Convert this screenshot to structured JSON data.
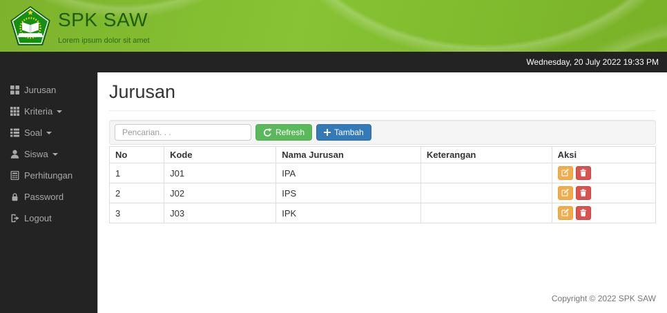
{
  "header": {
    "title": "SPK SAW",
    "subtitle": "Lorem ipsum dolor sit amet",
    "logo": "kemenag-pentagon-logo"
  },
  "topbar": {
    "datetime": "Wednesday, 20 July 2022 19:33 PM"
  },
  "sidebar": {
    "items": [
      {
        "label": "Jurusan",
        "icon": "th-large-icon",
        "caret": false
      },
      {
        "label": "Kriteria",
        "icon": "th-grid-icon",
        "caret": true
      },
      {
        "label": "Soal",
        "icon": "th-list-icon",
        "caret": true
      },
      {
        "label": "Siswa",
        "icon": "user-icon",
        "caret": true
      },
      {
        "label": "Perhitungan",
        "icon": "calculator-icon",
        "caret": false
      },
      {
        "label": "Password",
        "icon": "lock-icon",
        "caret": false
      },
      {
        "label": "Logout",
        "icon": "logout-icon",
        "caret": false
      }
    ]
  },
  "main": {
    "page_title": "Jurusan",
    "toolbar": {
      "search_placeholder": "Pencarian. . .",
      "search_value": "",
      "refresh_label": "Refresh",
      "refresh_icon": "refresh-icon",
      "add_label": "Tambah",
      "add_icon": "plus-icon"
    },
    "table": {
      "headers": [
        "No",
        "Kode",
        "Nama Jurusan",
        "Keterangan",
        "Aksi"
      ],
      "rows": [
        {
          "no": "1",
          "kode": "J01",
          "nama": "IPA",
          "keterangan": ""
        },
        {
          "no": "2",
          "kode": "J02",
          "nama": "IPS",
          "keterangan": ""
        },
        {
          "no": "3",
          "kode": "J03",
          "nama": "IPK",
          "keterangan": ""
        }
      ],
      "row_action_icons": [
        "edit-icon",
        "trash-icon"
      ]
    },
    "footer": "Copyright © 2022 SPK SAW"
  },
  "colors": {
    "header_green": "#7fb92d",
    "header_title_green": "#1d5c0e",
    "bar_dark": "#232323",
    "btn_refresh_green": "#5cb85c",
    "btn_add_blue": "#337ab7",
    "btn_edit_orange": "#f0ad4e",
    "btn_delete_red": "#d9534f"
  }
}
